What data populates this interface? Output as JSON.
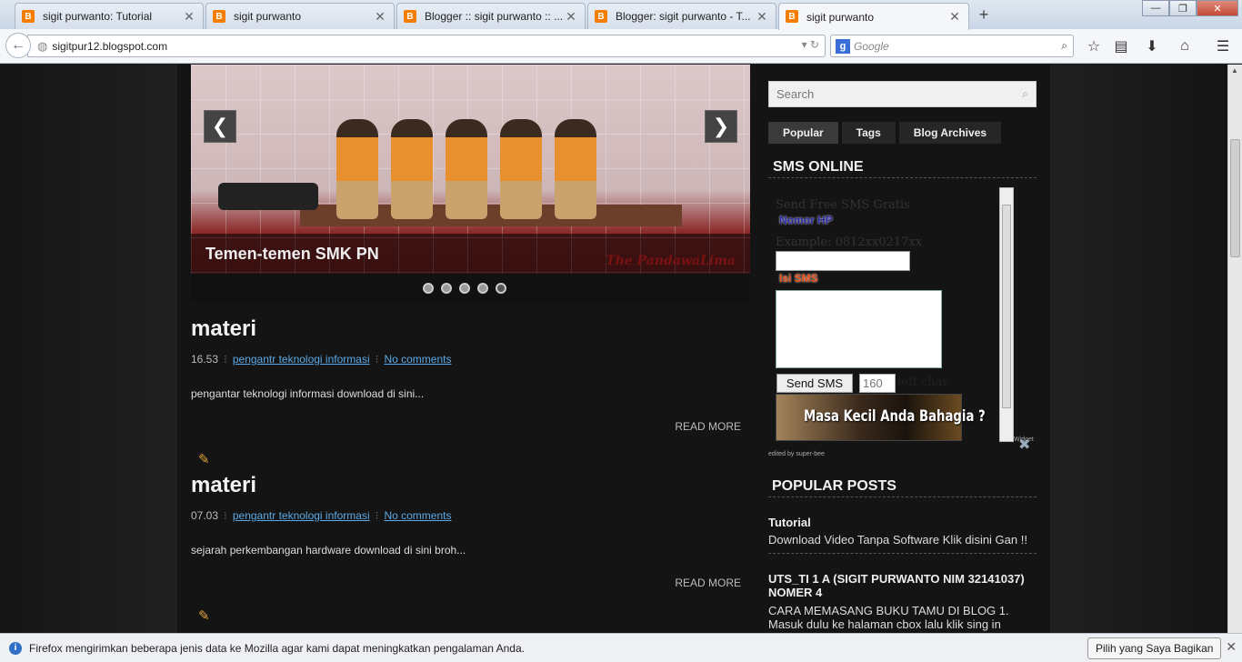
{
  "browser": {
    "tabs": [
      {
        "title": "sigit purwanto: Tutorial",
        "active": false
      },
      {
        "title": "sigit purwanto",
        "active": false
      },
      {
        "title": "Blogger :: sigit purwanto :: ...",
        "active": false
      },
      {
        "title": "Blogger: sigit purwanto - T...",
        "active": false
      },
      {
        "title": "sigit purwanto",
        "active": true
      }
    ],
    "url": "sigitpur12.blogspot.com",
    "search_placeholder": "Google",
    "new_tab": "+",
    "window_controls": {
      "minimize": "—",
      "restore": "❐",
      "close": "✕"
    }
  },
  "slider": {
    "caption": "Temen-temen SMK PN",
    "watermark": "The PandawaLima",
    "prev": "❮",
    "next": "❯",
    "dot_count": 5,
    "active_dot": 5
  },
  "posts": [
    {
      "title": "materi",
      "time": "16.53",
      "label": "pengantr teknologi informasi",
      "comments": "No comments",
      "excerpt": "pengantar teknologi informasi download di sini...",
      "read_more": "READ MORE"
    },
    {
      "title": "materi",
      "time": "07.03",
      "label": "pengantr teknologi informasi",
      "comments": "No comments",
      "excerpt": "sejarah perkembangan hardware download di sini broh...",
      "read_more": "READ MORE"
    }
  ],
  "sidebar": {
    "search_placeholder": "Search",
    "tabs": [
      "Popular",
      "Tags",
      "Blog Archives"
    ],
    "sms_title": "SMS ONLINE",
    "sms": {
      "heading": "Send Free SMS Gratis",
      "nomor_label": "Nomor HP",
      "example": "Example: 0812xx0217xx",
      "isi_label": "Isi SMS",
      "send_button": "Send SMS",
      "count": "160",
      "left_char": "left char",
      "banner_text": "Masa Kecil Anda Bahagia ?",
      "credit": "edited by super-bee",
      "widget_label": "Widget"
    },
    "popular_title": "POPULAR POSTS",
    "popular_posts": [
      {
        "title": "Tutorial",
        "snippet": "Download Video Tanpa Software Klik disini Gan !!"
      },
      {
        "title": "UTS_TI 1 A (SIGIT PURWANTO NIM 32141037) NOMER 4",
        "snippet": "CARA MEMASANG BUKU TAMU DI BLOG 1. Masuk dulu ke halaman cbox lalu klik sing in"
      }
    ]
  },
  "notification": {
    "text": "Firefox mengirimkan beberapa jenis data ke Mozilla agar kami dapat meningkatkan pengalaman Anda.",
    "button": "Pilih yang Saya Bagikan",
    "close": "✕"
  },
  "colors": {
    "accent_link": "#5aa9e6",
    "blogger_orange": "#f57d00",
    "nomor_label": "#2a2aa8",
    "isi_label": "#e84a10"
  }
}
